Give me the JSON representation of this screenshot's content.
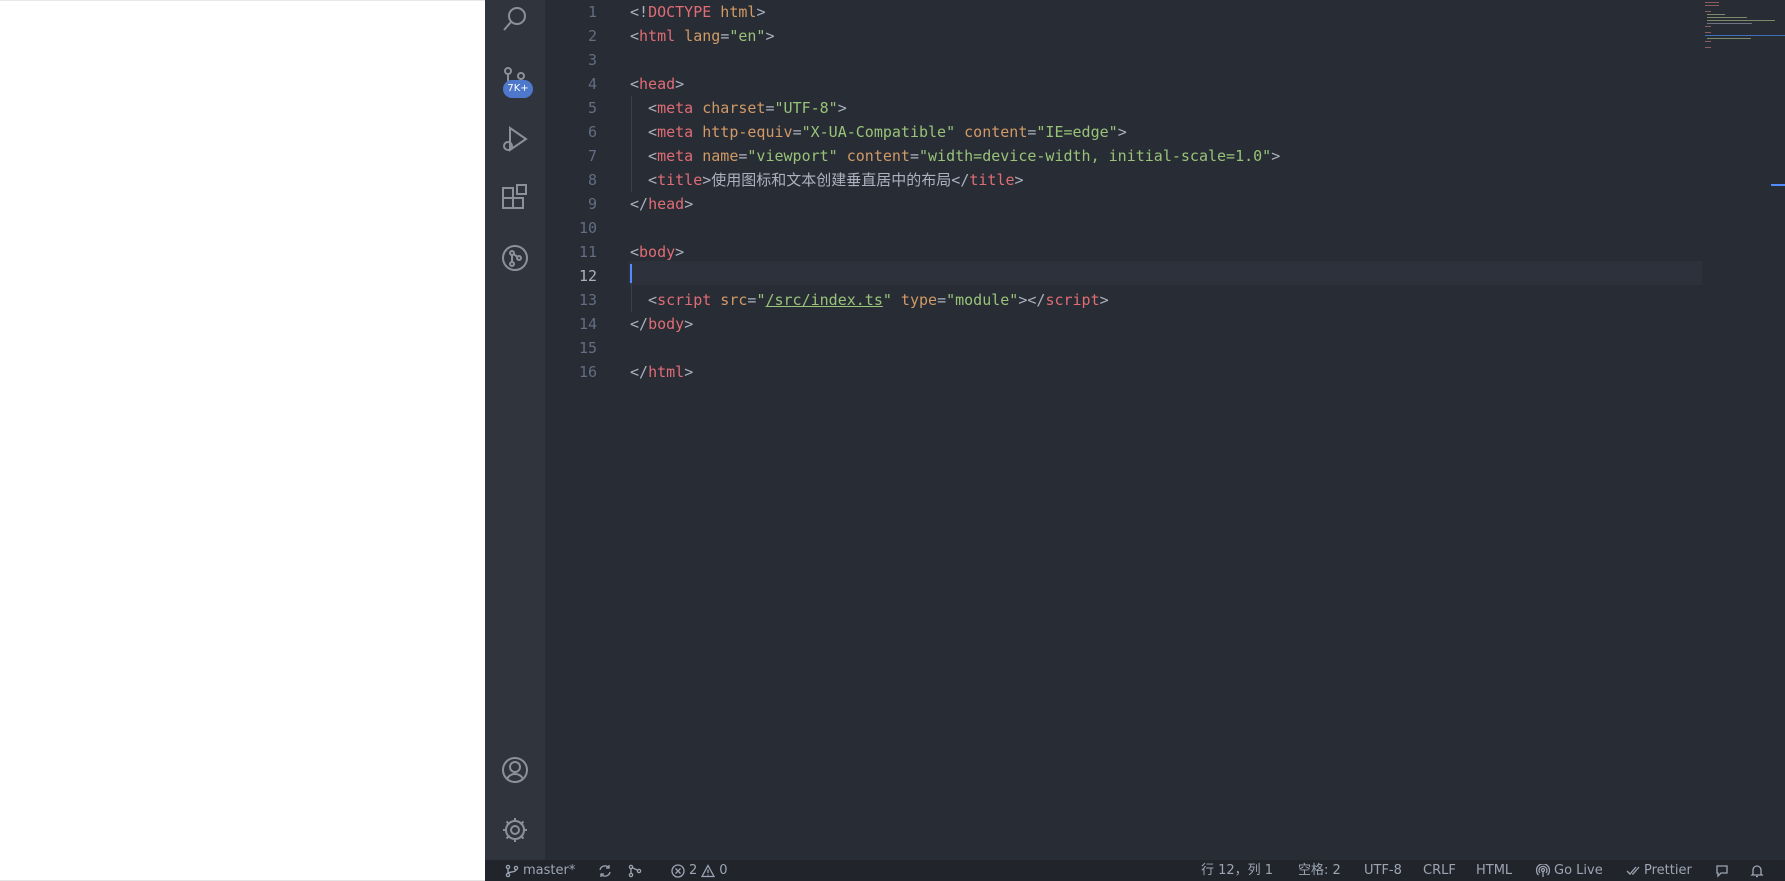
{
  "editor": {
    "line_numbers": [
      "1",
      "2",
      "3",
      "4",
      "5",
      "6",
      "7",
      "8",
      "9",
      "10",
      "11",
      "12",
      "13",
      "14",
      "15",
      "16"
    ],
    "active_line": "12",
    "code": {
      "l1": [
        "<!",
        "DOCTYPE",
        " html",
        ">"
      ],
      "l2": [
        "<",
        "html",
        " lang",
        "=",
        "\"en\"",
        ">"
      ],
      "l4": [
        "<",
        "head",
        ">"
      ],
      "l5": [
        "  <",
        "meta",
        " charset",
        "=",
        "\"UTF-8\"",
        ">"
      ],
      "l6": [
        "  <",
        "meta",
        " http-equiv",
        "=",
        "\"X-UA-Compatible\"",
        " content",
        "=",
        "\"IE=edge\"",
        ">"
      ],
      "l7": [
        "  <",
        "meta",
        " name",
        "=",
        "\"viewport\"",
        " content",
        "=",
        "\"width=device-width, initial-scale=1.0\"",
        ">"
      ],
      "l8": [
        "  <",
        "title",
        ">",
        "使用图标和文本创建垂直居中的布局",
        "</",
        "title",
        ">"
      ],
      "l9": [
        "</",
        "head",
        ">"
      ],
      "l11": [
        "<",
        "body",
        ">"
      ],
      "l13": [
        "  <",
        "script",
        " src",
        "=",
        "\"",
        "/src/index.ts",
        "\"",
        " type",
        "=",
        "\"module\"",
        "></",
        "script",
        ">"
      ],
      "l14": [
        "</",
        "body",
        ">"
      ],
      "l16": [
        "</",
        "html",
        ">"
      ]
    }
  },
  "activity_bar": {
    "items": [
      "search-icon",
      "source-control-icon",
      "run-debug-icon",
      "extensions-icon",
      "git-graph-icon"
    ],
    "source_control_badge": "7K+",
    "bottom_items": [
      "account-icon",
      "settings-gear-icon"
    ]
  },
  "status_bar": {
    "branch": "master*",
    "errors": "2",
    "warnings": "0",
    "position": "行 12，列 1",
    "spaces": "空格: 2",
    "encoding": "UTF-8",
    "eol": "CRLF",
    "language": "HTML",
    "go_live": "Go Live",
    "prettier": "Prettier"
  },
  "colors": {
    "editor_bg": "#282c34",
    "activity_bg": "#30343d",
    "status_bg": "#21252b",
    "tag": "#e06c75",
    "attribute": "#d19a66",
    "string": "#98c379",
    "badge": "#4d78cc"
  }
}
